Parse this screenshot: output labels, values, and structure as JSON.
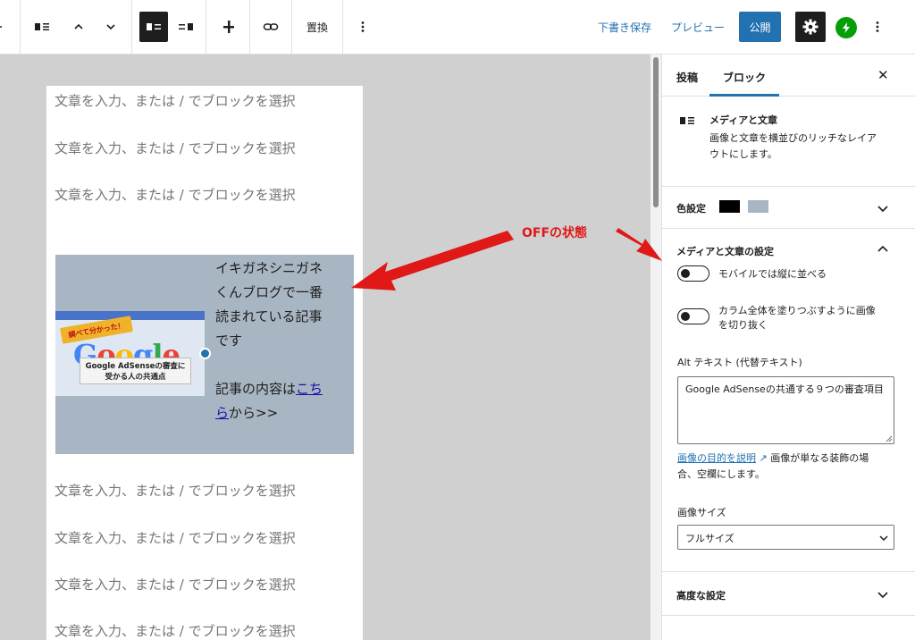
{
  "toolbar": {
    "replace_label": "置換",
    "save_draft": "下書き保存",
    "preview": "プレビュー",
    "publish": "公開"
  },
  "canvas": {
    "placeholder": "文章を入力、または / でブロックを選択",
    "media_text": {
      "image": {
        "ribbon": "調べて分かった！",
        "logo": "Google",
        "card_line1": "Google AdSenseの審査に",
        "card_line2": "受かる人の共通点"
      },
      "lines": [
        "イキガネシニガネ",
        "くんブログで一番",
        "読まれている記事",
        "です"
      ],
      "link_prefix": "記事の内容は",
      "link_text_1": "こち",
      "link_text_2": "ら",
      "link_suffix": "から>>"
    }
  },
  "annotation": {
    "label": "OFFの状態",
    "color": "#e01818"
  },
  "sidebar": {
    "tabs": [
      "投稿",
      "ブロック"
    ],
    "active_tab": "ブロック",
    "block": {
      "title": "メディアと文章",
      "desc_line1": "画像と文章を横並びのリッチなレイア",
      "desc_line2": "ウトにします。"
    },
    "color_settings": {
      "title": "色設定",
      "text_color": "#000000",
      "background_color": "#a8b5c2"
    },
    "media_settings": {
      "title": "メディアと文章の設定",
      "stack_on_mobile": "モバイルでは縦に並べる",
      "stack_on_mobile_on": false,
      "crop_line1": "カラム全体を塗りつぶすように画像",
      "crop_line2": "を切り抜く",
      "crop_on": false,
      "alt_label": "Alt テキスト (代替テキスト)",
      "alt_value": "Google AdSenseの共通する９つの審査項目",
      "help_link": "画像の目的を説明",
      "help_rest": " 画像が単なる装飾の場",
      "help_line2": "合、空欄にします。",
      "image_size_label": "画像サイズ",
      "image_size_value": "フルサイズ"
    },
    "advanced": {
      "title": "高度な設定"
    }
  }
}
